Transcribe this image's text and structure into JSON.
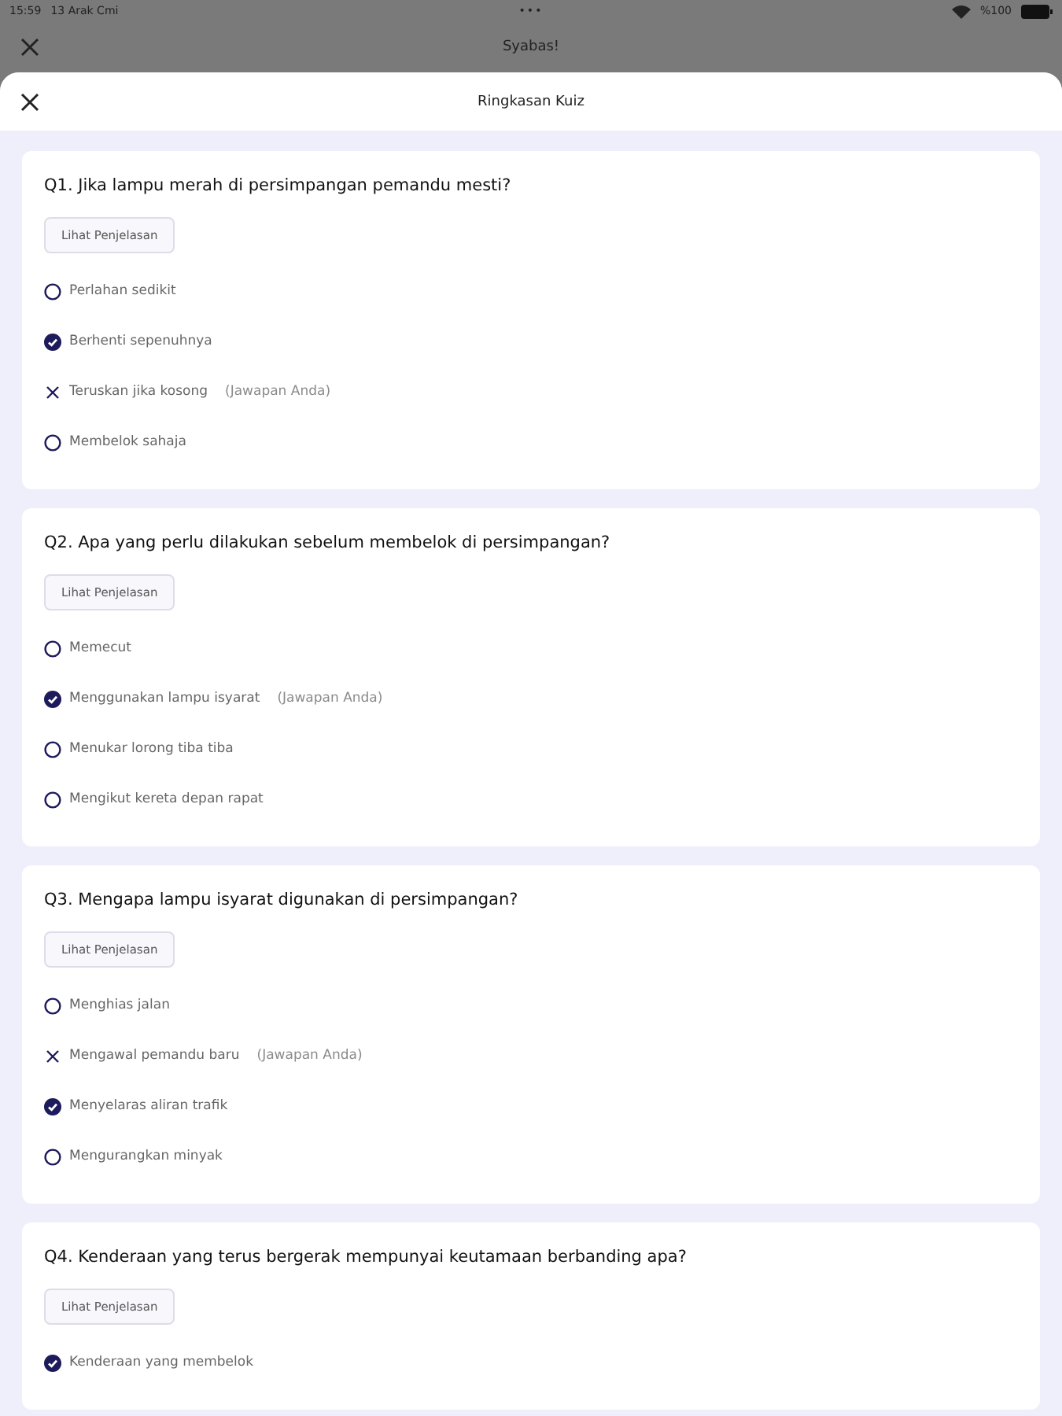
{
  "status_bar": {
    "time": "15:59",
    "date": "13 Arak Cmi",
    "dots": "•••",
    "battery": "%100"
  },
  "back_screen": {
    "title": "Syabas!"
  },
  "sheet": {
    "title": "Ringkasan Kuiz"
  },
  "questions": [
    {
      "question": "Q1. Jika lampu merah di persimpangan pemandu mesti?",
      "button": "Lihat Penjelasan",
      "options": [
        {
          "kind": "circle",
          "text": "Perlahan sedikit"
        },
        {
          "kind": "check",
          "text": "Berhenti sepenuhnya"
        },
        {
          "kind": "cross",
          "text": "Teruskan jika kosong",
          "note": "(Jawapan Anda)"
        },
        {
          "kind": "circle",
          "text": "Membelok sahaja"
        }
      ]
    },
    {
      "question": "Q2. Apa yang perlu dilakukan sebelum membelok di persimpangan?",
      "button": "Lihat Penjelasan",
      "options": [
        {
          "kind": "circle",
          "text": "Memecut"
        },
        {
          "kind": "check",
          "text": "Menggunakan lampu isyarat",
          "note": "(Jawapan Anda)"
        },
        {
          "kind": "circle",
          "text": "Menukar lorong tiba tiba"
        },
        {
          "kind": "circle",
          "text": "Mengikut kereta depan rapat"
        }
      ]
    },
    {
      "question": "Q3. Mengapa lampu isyarat digunakan di persimpangan?",
      "button": "Lihat Penjelasan",
      "options": [
        {
          "kind": "circle",
          "text": "Menghias jalan"
        },
        {
          "kind": "cross",
          "text": "Mengawal pemandu baru",
          "note": "(Jawapan Anda)"
        },
        {
          "kind": "check",
          "text": "Menyelaras aliran trafik"
        },
        {
          "kind": "circle",
          "text": "Mengurangkan minyak"
        }
      ]
    },
    {
      "question": "Q4. Kenderaan yang terus bergerak mempunyai keutamaan berbanding apa?",
      "button": "Lihat Penjelasan",
      "options": [
        {
          "kind": "check",
          "text": "Kenderaan yang membelok"
        }
      ]
    }
  ]
}
